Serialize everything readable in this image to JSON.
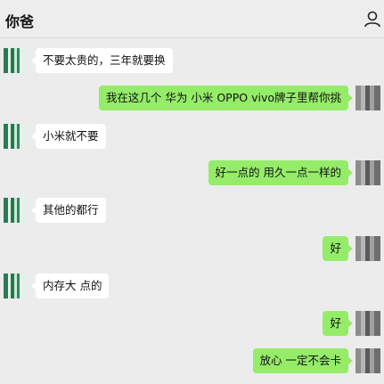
{
  "header": {
    "title": "你爸",
    "profile_icon": "person-icon"
  },
  "colors": {
    "background": "#ececec",
    "bubble_self": "#95ec69",
    "bubble_other": "#ffffff"
  },
  "messages": [
    {
      "from": "other",
      "text": "不要太贵的，三年就要换"
    },
    {
      "from": "self",
      "text": "我在这几个 华为 小米 OPPO vivo牌子里帮你挑"
    },
    {
      "from": "other",
      "text": "小米就不要"
    },
    {
      "from": "self",
      "text": "好一点的 用久一点一样的"
    },
    {
      "from": "other",
      "text": "其他的都行"
    },
    {
      "from": "self",
      "text": "好"
    },
    {
      "from": "other",
      "text": "内存大 点的"
    },
    {
      "from": "self",
      "text": "好"
    },
    {
      "from": "self",
      "text": "放心 一定不会卡"
    }
  ]
}
